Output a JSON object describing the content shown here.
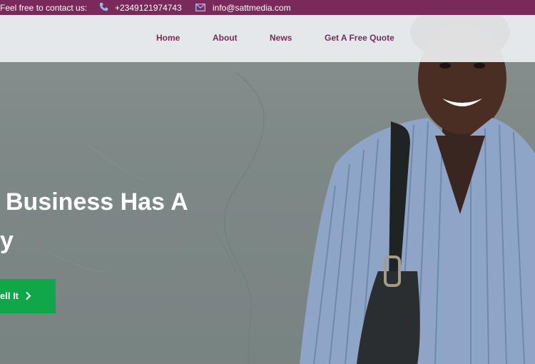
{
  "topbar": {
    "contact_prompt": "Feel free to contact us:",
    "phone": "+2349121974743",
    "email": "info@sattmedia.com"
  },
  "nav": {
    "items": [
      "Home",
      "About",
      "News",
      "Get A Free Quote"
    ]
  },
  "hero": {
    "headline_line1": "Business Has A",
    "headline_line2": "y",
    "cta_label": "ell It"
  },
  "colors": {
    "brand": "#7a2a5a",
    "cta": "#11a64a",
    "header_bg": "#eef0f2"
  },
  "icons": {
    "phone": "phone-icon",
    "mail": "mail-icon",
    "cta_arrow": "chevron-right-icon"
  }
}
